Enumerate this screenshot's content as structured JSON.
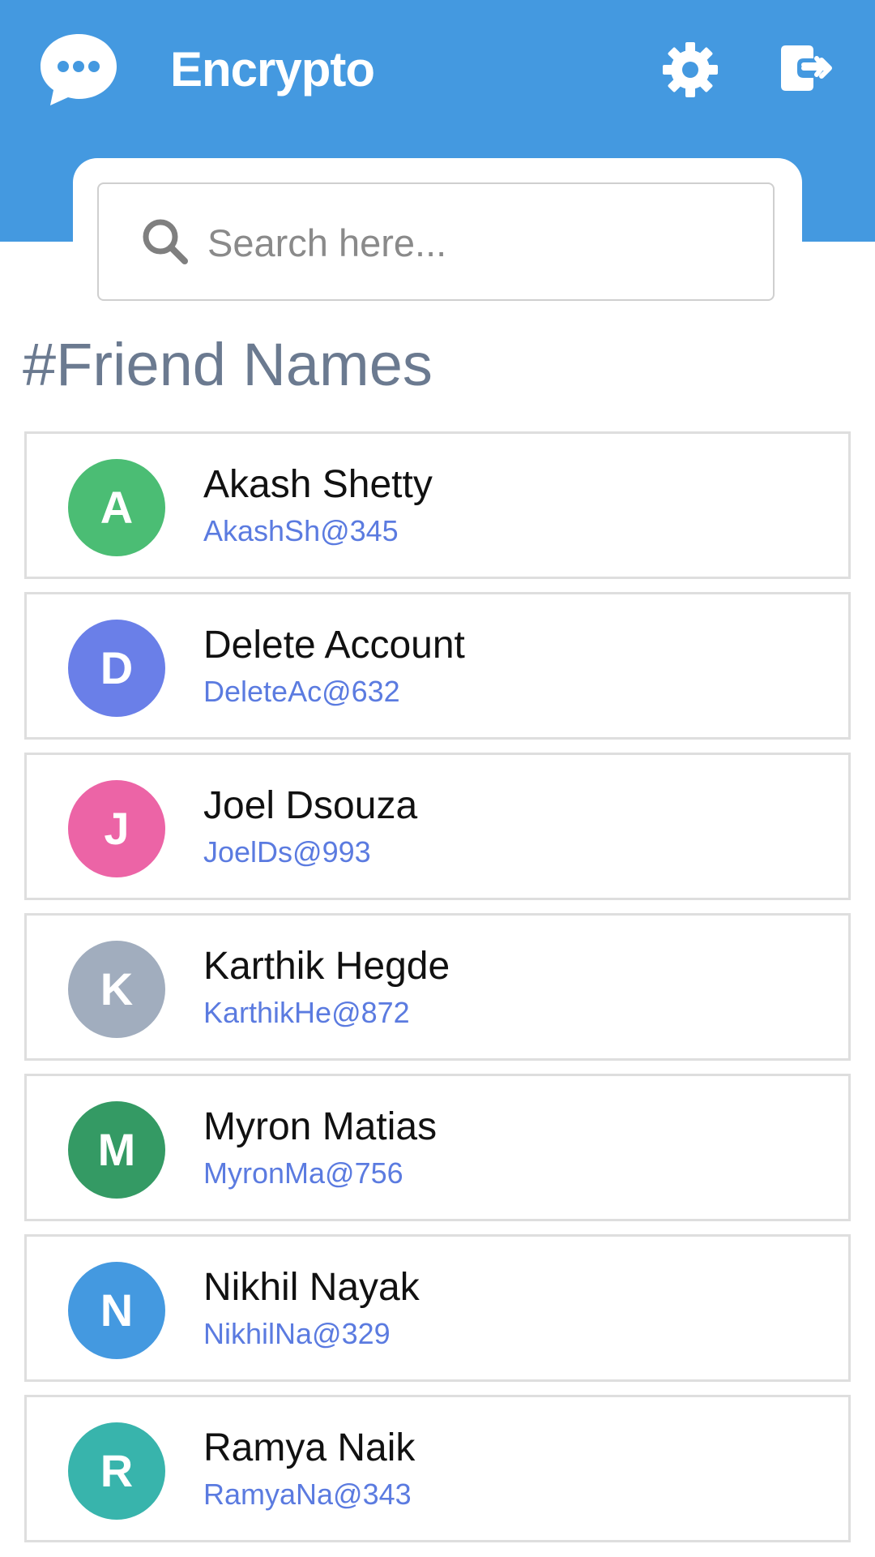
{
  "header": {
    "app_title": "Encrypto",
    "background_color": "#4499e0",
    "logo_icon": "chat-bubble-icon",
    "settings_icon": "gear-icon",
    "logout_icon": "sign-out-icon"
  },
  "search": {
    "placeholder": "Search here...",
    "value": "",
    "icon": "search-icon"
  },
  "section": {
    "title": "#Friend Names"
  },
  "friends": [
    {
      "initial": "A",
      "name": "Akash Shetty",
      "handle": "AkashSh@345",
      "color": "#4bbd74"
    },
    {
      "initial": "D",
      "name": "Delete Account",
      "handle": "DeleteAc@632",
      "color": "#6a7fe8"
    },
    {
      "initial": "J",
      "name": "Joel Dsouza",
      "handle": "JoelDs@993",
      "color": "#ec64a6"
    },
    {
      "initial": "K",
      "name": "Karthik Hegde",
      "handle": "KarthikHe@872",
      "color": "#a1adbe"
    },
    {
      "initial": "M",
      "name": "Myron Matias",
      "handle": "MyronMa@756",
      "color": "#349a64"
    },
    {
      "initial": "N",
      "name": "Nikhil Nayak",
      "handle": "NikhilNa@329",
      "color": "#4499e0"
    },
    {
      "initial": "R",
      "name": "Ramya Naik",
      "handle": "RamyaNa@343",
      "color": "#38b4ac"
    }
  ]
}
